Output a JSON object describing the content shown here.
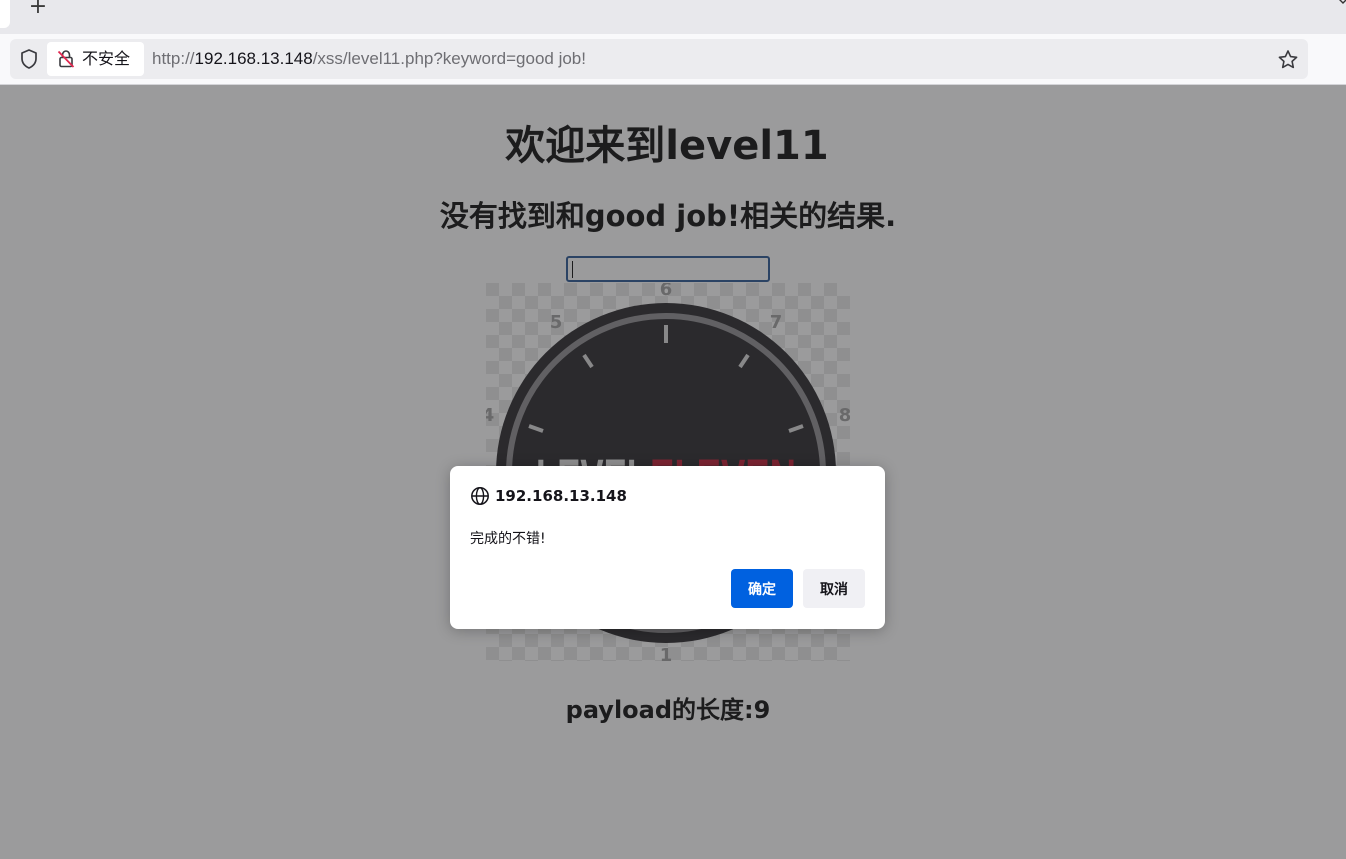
{
  "browser": {
    "new_tab_glyph": "+",
    "security_label": "不安全",
    "url_scheme": "http://",
    "url_host": "192.168.13.148",
    "url_path": "/xss/level11.php?keyword=good job!",
    "icons": [
      "shield-icon",
      "insecure-icon",
      "star-icon"
    ]
  },
  "page": {
    "title": "欢迎来到level11",
    "subtitle": "没有找到和good job!相关的结果.",
    "search_value": "",
    "image": {
      "word_left": "LEVEL",
      "word_right": "ELEVEN",
      "dial_numbers": [
        "6",
        "5",
        "7",
        "4",
        "8",
        "1"
      ],
      "word_right_color": "#c0112a"
    },
    "payload_length": "payload的长度:9"
  },
  "dialog": {
    "origin": "192.168.13.148",
    "message": "完成的不错!",
    "ok_label": "确定",
    "cancel_label": "取消",
    "ok_color": "#0061e0"
  }
}
